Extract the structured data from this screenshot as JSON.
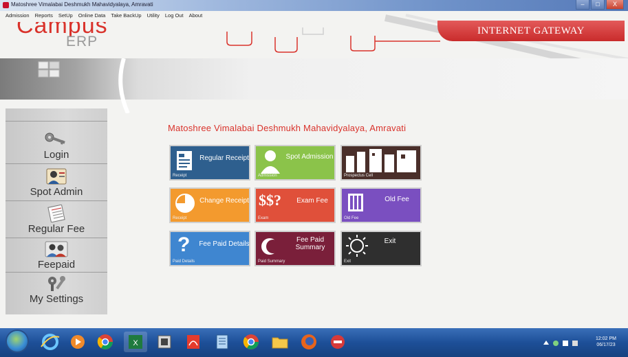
{
  "window": {
    "title": "Matoshree Vimalabai Deshmukh Mahavidyalaya, Amravati",
    "buttons": {
      "minimize": "–",
      "maximize": "□",
      "close": "X"
    }
  },
  "menu": [
    "Admission",
    "Reports",
    "SetUp",
    "Online Data",
    "Take BackUp",
    "Utility",
    "Log Out",
    "About"
  ],
  "header": {
    "logo_main": "Campus",
    "logo_sub": "ERP",
    "gateway_label": "INTERNET GATEWAY",
    "accent": "#d9322b"
  },
  "sidebar": {
    "items": [
      {
        "label": "Login",
        "icon": "key-icon"
      },
      {
        "label": "Spot Admin",
        "icon": "user-card-icon"
      },
      {
        "label": "Regular Fee",
        "icon": "notepad-icon"
      },
      {
        "label": "Feepaid",
        "icon": "users-icon"
      },
      {
        "label": "My Settings",
        "icon": "tools-icon"
      }
    ]
  },
  "main": {
    "college_name": "Matoshree Vimalabai Deshmukh Mahavidyalaya, Amravati",
    "tiles": [
      {
        "title": "Regular Receipt",
        "sub": "Receipt",
        "color": "#2e5f8e",
        "icon": "receipt-icon"
      },
      {
        "title": "Spot Admission",
        "sub": "Admission",
        "color": "#8bc34a",
        "icon": "person-icon"
      },
      {
        "title": "",
        "sub": "Prospectus Cell",
        "color": "#4a2f2a",
        "icon": "building-icon"
      },
      {
        "title": "Change Receipt",
        "sub": "Receipt",
        "color": "#f39a2e",
        "icon": "pie-icon"
      },
      {
        "title": "Exam Fee",
        "sub": "Exam",
        "color": "#e0503a",
        "icon": "dollar-icon",
        "icon_text": "$$?"
      },
      {
        "title": "Old Fee",
        "sub": "Old Fee",
        "color": "#7a4fc0",
        "icon": "book-icon"
      },
      {
        "title": "Fee Paid Details",
        "sub": "Paid Details",
        "color": "#3f86d0",
        "icon": "question-icon",
        "icon_text": "?"
      },
      {
        "title": "Fee Paid Summary",
        "sub": "Paid Summary",
        "color": "#7a1f3a",
        "icon": "moon-icon"
      },
      {
        "title": "Exit",
        "sub": "Exit",
        "color": "#2f2f2f",
        "icon": "sun-icon"
      }
    ]
  },
  "taskbar": {
    "apps": [
      "ie-icon",
      "media-player-icon",
      "chrome-icon",
      "excel-icon",
      "install-icon",
      "pdf-icon",
      "notepad-icon",
      "chrome-icon",
      "folder-icon",
      "firefox-icon",
      "app-icon"
    ],
    "clock_time": "12:02 PM",
    "clock_date": "06/17/23"
  }
}
